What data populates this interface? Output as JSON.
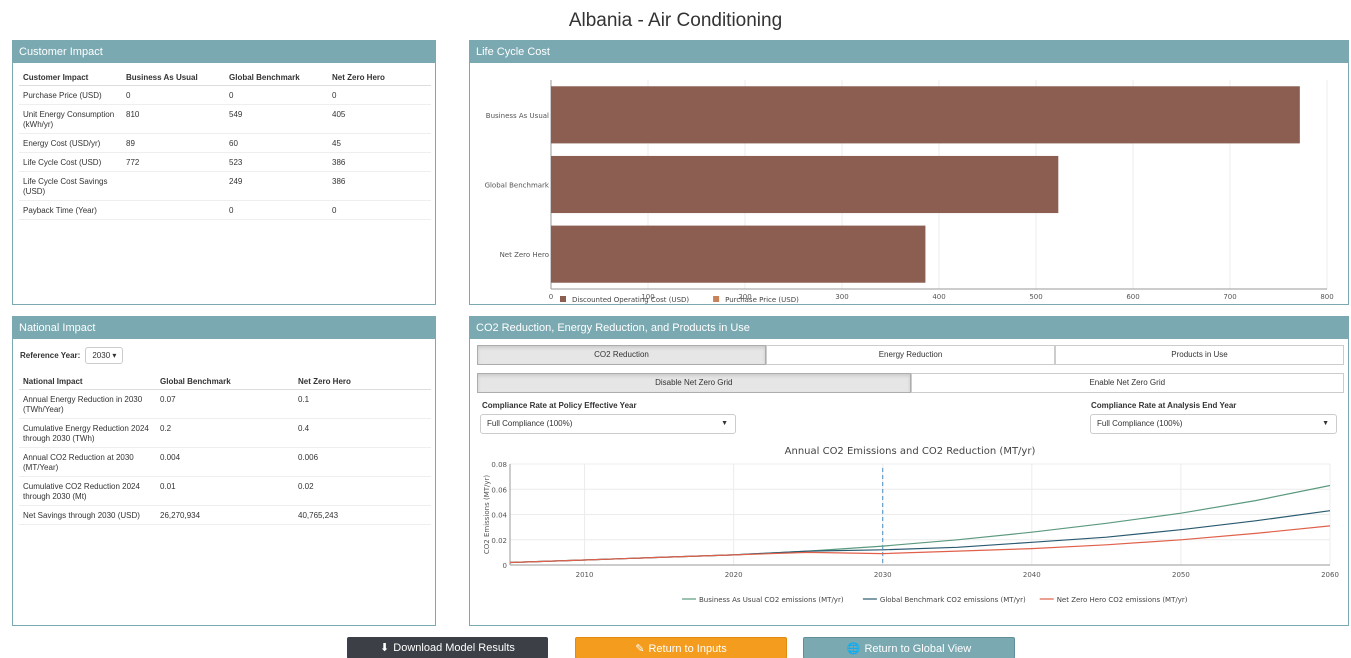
{
  "page_title": "Albania - Air Conditioning",
  "customer": {
    "title": "Customer Impact",
    "headers": [
      "Customer Impact",
      "Business As Usual",
      "Global Benchmark",
      "Net Zero Hero"
    ],
    "rows": [
      [
        "Purchase Price (USD)",
        "0",
        "0",
        "0"
      ],
      [
        "Unit Energy Consumption (kWh/yr)",
        "810",
        "549",
        "405"
      ],
      [
        "Energy Cost (USD/yr)",
        "89",
        "60",
        "45"
      ],
      [
        "Life Cycle Cost (USD)",
        "772",
        "523",
        "386"
      ],
      [
        "Life Cycle Cost Savings (USD)",
        "",
        "249",
        "386"
      ],
      [
        "Payback Time (Year)",
        "",
        "0",
        "0"
      ]
    ]
  },
  "lcc": {
    "title": "Life Cycle Cost"
  },
  "national": {
    "title": "National Impact",
    "ref_label": "Reference Year:",
    "ref_value": "2030 ▾",
    "headers": [
      "National Impact",
      "Global Benchmark",
      "Net Zero Hero"
    ],
    "rows": [
      [
        "Annual Energy Reduction in 2030 (TWh/Year)",
        "0.07",
        "0.1"
      ],
      [
        "Cumulative Energy Reduction 2024 through 2030 (TWh)",
        "0.2",
        "0.4"
      ],
      [
        "Annual CO2 Reduction at 2030 (MT/Year)",
        "0.004",
        "0.006"
      ],
      [
        "Cumulative CO2 Reduction 2024 through 2030 (Mt)",
        "0.01",
        "0.02"
      ],
      [
        "Net Savings through 2030 (USD)",
        "26,270,934",
        "40,765,243"
      ]
    ]
  },
  "co2": {
    "title": "CO2 Reduction, Energy Reduction, and Products in Use",
    "tabs": [
      "CO2 Reduction",
      "Energy Reduction",
      "Products in Use"
    ],
    "grid_tabs": [
      "Disable Net Zero Grid",
      "Enable Net Zero Grid"
    ],
    "left_label": "Compliance Rate at Policy Effective Year",
    "left_value": "Full Compliance (100%)",
    "right_label": "Compliance Rate at Analysis End Year",
    "right_value": "Full Compliance (100%)"
  },
  "buttons": {
    "download": "Download Model Results",
    "return_inputs": "Return to Inputs",
    "return_global": "Return to Global View"
  },
  "colors": {
    "panel_header": "#7aa9b1",
    "bar_operating": "#8b5e51",
    "bar_purchase": "#c9825a",
    "bau": "#5b9a7f",
    "gb": "#2a5a70",
    "nzh": "#e0604a",
    "btn_download": "#3c4046",
    "btn_inputs": "#f39c1e",
    "btn_global": "#7aa9b1"
  },
  "chart_data": [
    {
      "type": "bar",
      "orientation": "horizontal",
      "categories": [
        "Business As Usual",
        "Global Benchmark",
        "Net Zero Hero"
      ],
      "series": [
        {
          "name": "Discounted Operating Cost (USD)",
          "values": [
            772,
            523,
            386
          ]
        },
        {
          "name": "Purchase Price (USD)",
          "values": [
            0,
            0,
            0
          ]
        }
      ],
      "xlim": [
        0,
        800
      ],
      "xticks": [
        "0",
        "100",
        "200",
        "300",
        "400",
        "500",
        "600",
        "700",
        "800"
      ],
      "legend": "bottom-left",
      "title": "",
      "xlabel": "",
      "ylabel": ""
    },
    {
      "type": "line",
      "title": "Annual CO2 Emissions and CO2 Reduction (MT/yr)",
      "ylabel": "CO2 Emissions (MT/yr)",
      "xlabel": "",
      "xlim": [
        2005,
        2060
      ],
      "ylim": [
        0,
        0.08
      ],
      "xticks": [
        "2010",
        "2020",
        "2030",
        "2040",
        "2050",
        "2060"
      ],
      "yticks": [
        "0",
        "0.02",
        "0.04",
        "0.06",
        "0.08"
      ],
      "x": [
        2005,
        2010,
        2015,
        2020,
        2025,
        2030,
        2035,
        2040,
        2045,
        2050,
        2055,
        2060
      ],
      "series": [
        {
          "name": "Business As Usual CO2 emissions (MT/yr)",
          "values": [
            0.002,
            0.004,
            0.006,
            0.008,
            0.011,
            0.015,
            0.02,
            0.026,
            0.033,
            0.041,
            0.051,
            0.063
          ]
        },
        {
          "name": "Global Benchmark CO2 emissions (MT/yr)",
          "values": [
            0.002,
            0.004,
            0.006,
            0.008,
            0.011,
            0.012,
            0.014,
            0.018,
            0.022,
            0.028,
            0.035,
            0.043
          ]
        },
        {
          "name": "Net Zero Hero CO2 emissions (MT/yr)",
          "values": [
            0.002,
            0.004,
            0.006,
            0.008,
            0.01,
            0.009,
            0.011,
            0.013,
            0.016,
            0.02,
            0.025,
            0.031
          ]
        }
      ],
      "marker_line_x": 2030,
      "legend": "bottom-center"
    }
  ]
}
